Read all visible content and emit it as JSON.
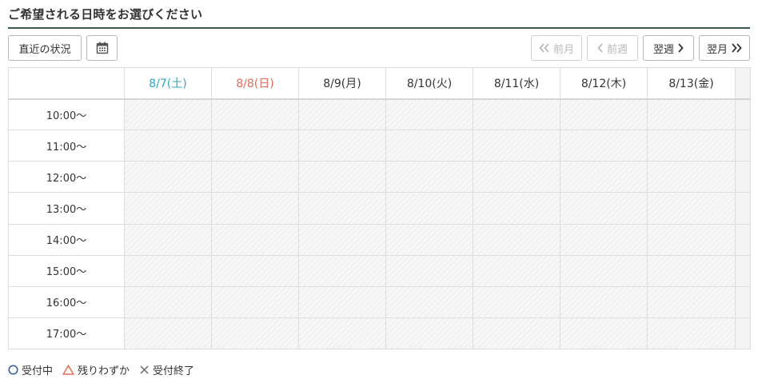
{
  "heading": "ご希望される日時をお選びください",
  "toolbar": {
    "recent_label": "直近の状況",
    "calendar_icon": "calendar-icon",
    "prev_month_label": "前月",
    "prev_week_label": "前週",
    "next_week_label": "翌週",
    "next_month_label": "翌月"
  },
  "days": [
    {
      "label": "8/7(土)",
      "type": "saturday"
    },
    {
      "label": "8/8(日)",
      "type": "sunday"
    },
    {
      "label": "8/9(月)",
      "type": "weekday"
    },
    {
      "label": "8/10(火)",
      "type": "weekday"
    },
    {
      "label": "8/11(水)",
      "type": "weekday"
    },
    {
      "label": "8/12(木)",
      "type": "weekday"
    },
    {
      "label": "8/13(金)",
      "type": "weekday"
    }
  ],
  "times": [
    "10:00〜",
    "11:00〜",
    "12:00〜",
    "13:00〜",
    "14:00〜",
    "15:00〜",
    "16:00〜",
    "17:00〜"
  ],
  "legend": {
    "available": "受付中",
    "few_left": "残りわずか",
    "closed": "受付終了"
  },
  "colors": {
    "saturday": "#2da6c9",
    "sunday": "#e36d5a",
    "available_icon": "#2f5fa8",
    "few_left_icon": "#e36d5a",
    "closed_icon": "#777777",
    "heading_rule": "#3a5a4a"
  }
}
